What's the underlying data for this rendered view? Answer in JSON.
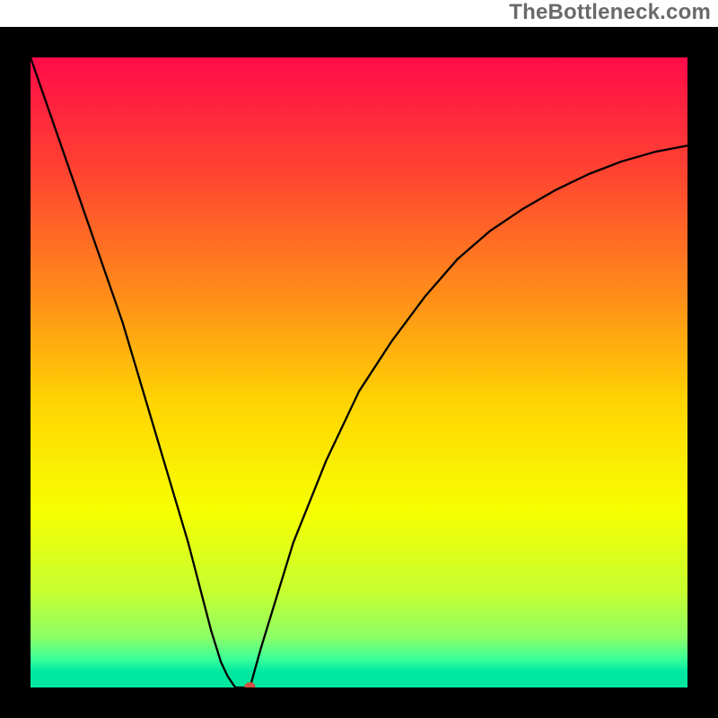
{
  "watermark": "TheBottleneck.com",
  "chart_data": {
    "type": "line",
    "title": "",
    "xlabel": "",
    "ylabel": "",
    "xlim": [
      0,
      100
    ],
    "ylim": [
      0,
      100
    ],
    "grid": false,
    "legend": false,
    "background_gradient": {
      "direction": "vertical",
      "stops": [
        {
          "pos": 0.0,
          "color": "#ff0b49"
        },
        {
          "pos": 0.18,
          "color": "#ff4331"
        },
        {
          "pos": 0.38,
          "color": "#ff8e19"
        },
        {
          "pos": 0.55,
          "color": "#ffd502"
        },
        {
          "pos": 0.72,
          "color": "#f6ff02"
        },
        {
          "pos": 0.85,
          "color": "#c5ff31"
        },
        {
          "pos": 0.92,
          "color": "#8cff66"
        },
        {
          "pos": 0.955,
          "color": "#3aff9a"
        },
        {
          "pos": 0.975,
          "color": "#00e8a0"
        },
        {
          "pos": 1.0,
          "color": "#00e8a0"
        }
      ]
    },
    "bottom_green_band": {
      "color": "#00e8a0",
      "height_pct": 2.2
    },
    "series": [
      {
        "name": "bottleneck-curve",
        "stroke": "#000000",
        "stroke_width": 2.3,
        "x": [
          0,
          2,
          4,
          6,
          8,
          10,
          12,
          14,
          16,
          18,
          20,
          22,
          24,
          26,
          27.5,
          29,
          30,
          30.9,
          31.2,
          33.4,
          35,
          40,
          45,
          50,
          55,
          60,
          65,
          70,
          75,
          80,
          85,
          90,
          95,
          100
        ],
        "y": [
          100,
          94,
          88,
          82,
          76,
          70,
          64,
          58,
          51,
          44,
          37,
          30,
          23,
          15,
          9,
          4,
          1.8,
          0.4,
          0.0,
          0.0,
          6,
          23,
          36,
          47,
          55,
          62,
          68,
          72.5,
          76,
          79,
          81.5,
          83.5,
          85,
          86
        ]
      }
    ],
    "marker": {
      "name": "optimal-point",
      "x": 33.4,
      "y": 0,
      "rx": 6,
      "ry": 5,
      "color": "#d04f3f"
    },
    "frame": {
      "stroke": "#000000",
      "stroke_width": 34
    }
  }
}
